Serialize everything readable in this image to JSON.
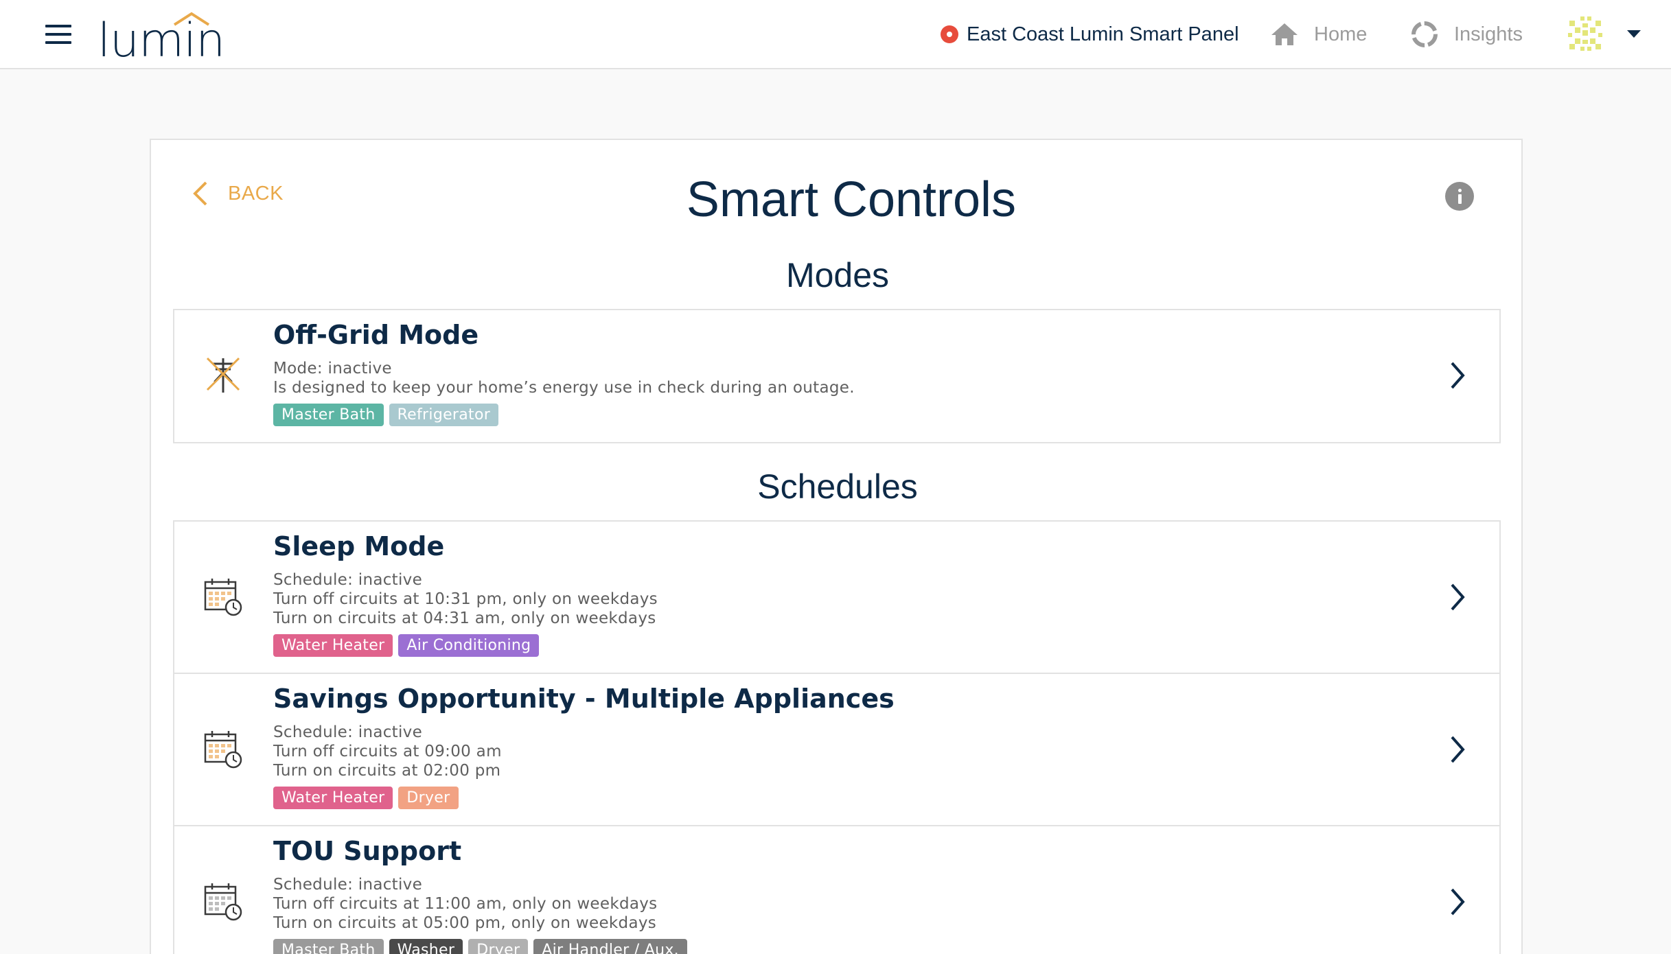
{
  "header": {
    "logo_text": "lumin",
    "panel_name": "East Coast Lumin Smart Panel",
    "panel_status_color": "#e74c3c",
    "nav": [
      {
        "label": "Home",
        "icon": "home-icon"
      },
      {
        "label": "Insights",
        "icon": "insights-ring-icon"
      }
    ]
  },
  "page": {
    "back_label": "BACK",
    "title": "Smart Controls",
    "modes_title": "Modes",
    "schedules_title": "Schedules"
  },
  "modes": [
    {
      "title": "Off-Grid Mode",
      "icon": "utility-pole-off-icon",
      "lines": [
        "Mode: inactive",
        "Is designed to keep your home’s energy use in check during an outage."
      ],
      "tags": [
        {
          "label": "Master Bath",
          "color": "#5cb5a4"
        },
        {
          "label": "Refrigerator",
          "color": "#a9c9cf"
        }
      ]
    }
  ],
  "schedules": [
    {
      "title": "Sleep Mode",
      "icon": "calendar-clock-icon",
      "lines": [
        "Schedule: inactive",
        "Turn off circuits at 10:31 pm, only on weekdays",
        "Turn on circuits at 04:31 am, only on weekdays"
      ],
      "tags": [
        {
          "label": "Water Heater",
          "color": "#e0628c"
        },
        {
          "label": "Air Conditioning",
          "color": "#9b6fd3"
        }
      ]
    },
    {
      "title": "Savings Opportunity - Multiple Appliances",
      "icon": "calendar-clock-icon",
      "lines": [
        "Schedule: inactive",
        "Turn off circuits at 09:00 am",
        "Turn on circuits at 02:00 pm"
      ],
      "tags": [
        {
          "label": "Water Heater",
          "color": "#e0628c"
        },
        {
          "label": "Dryer",
          "color": "#f2a283"
        }
      ]
    },
    {
      "title": "TOU Support",
      "icon": "calendar-clock-icon",
      "lines": [
        "Schedule: inactive",
        "Turn off circuits at 11:00 am, only on weekdays",
        "Turn on circuits at 05:00 pm, only on weekdays"
      ],
      "tags": [
        {
          "label": "Master Bath",
          "color": "#9a9a9a"
        },
        {
          "label": "Washer",
          "color": "#4a4a4a"
        },
        {
          "label": "Dryer",
          "color": "#b0b0b0"
        },
        {
          "label": "Air Handler / Aux.",
          "color": "#7e7e7e"
        }
      ]
    }
  ]
}
